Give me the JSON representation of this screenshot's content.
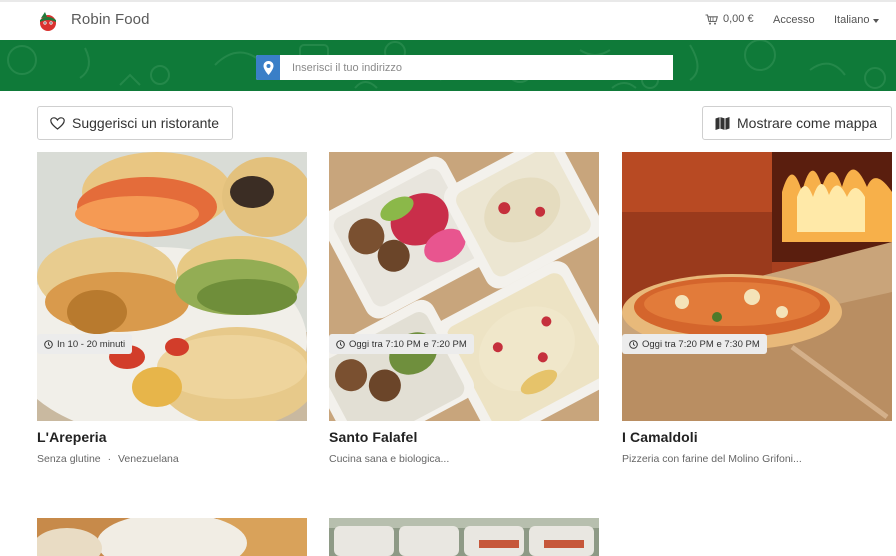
{
  "header": {
    "brand": "Robin Food",
    "cart_total": "0,00 €",
    "login": "Accesso",
    "language": "Italiano"
  },
  "search": {
    "placeholder": "Inserisci il tuo indirizzo"
  },
  "actions": {
    "suggest": "Suggerisci un ristorante",
    "map": "Mostrare come mappa"
  },
  "restaurants": [
    {
      "name": "L'Areperia",
      "tags": [
        "Senza glutine",
        "Venezuelana"
      ],
      "tag_separator": "·",
      "availability": "In 10 - 20 minuti"
    },
    {
      "name": "Santo Falafel",
      "description": "Cucina sana e biologica...",
      "availability": "Oggi tra 7:10 PM e 7:20 PM"
    },
    {
      "name": "I Camaldoli",
      "description": "Pizzeria con farine del Molino Grifoni...",
      "availability": "Oggi tra 7:20 PM e 7:30 PM"
    }
  ],
  "colors": {
    "hero_green": "#0f7a39",
    "pin_blue": "#3a7fc7",
    "badge_bg": "#ececec"
  },
  "icons": {
    "logo": "robin-food-logo",
    "cart": "cart-icon",
    "pin": "map-pin-icon",
    "heart": "heart-icon",
    "map": "map-icon",
    "clock": "clock-icon"
  }
}
